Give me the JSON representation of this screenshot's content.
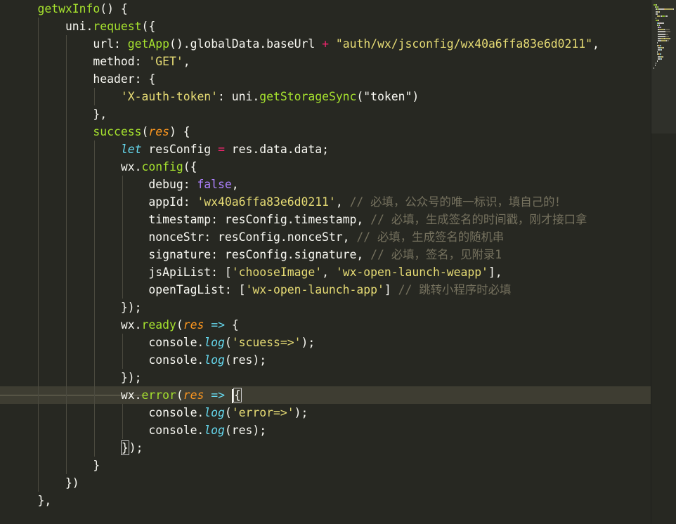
{
  "editor": {
    "lines": [
      [
        {
          "t": "    getwxInfo",
          "c": "fn"
        },
        {
          "t": "() {",
          "c": "plain"
        }
      ],
      [
        {
          "t": "        uni.",
          "c": "plain"
        },
        {
          "t": "request",
          "c": "fn"
        },
        {
          "t": "({",
          "c": "plain"
        }
      ],
      [
        {
          "t": "            url: ",
          "c": "plain"
        },
        {
          "t": "getApp",
          "c": "fn"
        },
        {
          "t": "().globalData.baseUrl ",
          "c": "plain"
        },
        {
          "t": "+",
          "c": "op"
        },
        {
          "t": " ",
          "c": "plain"
        },
        {
          "t": "\"auth/wx/jsconfig/wx40a6ffa83e6d0211\"",
          "c": "str"
        },
        {
          "t": ",",
          "c": "plain"
        }
      ],
      [
        {
          "t": "            method: ",
          "c": "plain"
        },
        {
          "t": "'GET'",
          "c": "str"
        },
        {
          "t": ",",
          "c": "plain"
        }
      ],
      [
        {
          "t": "            header: {",
          "c": "plain"
        }
      ],
      [
        {
          "t": "                ",
          "c": "plain"
        },
        {
          "t": "'X-auth-token'",
          "c": "str"
        },
        {
          "t": ": uni.",
          "c": "plain"
        },
        {
          "t": "getStorageSync",
          "c": "fn"
        },
        {
          "t": "(\"token\")",
          "c": "plain"
        }
      ],
      [
        {
          "t": "            },",
          "c": "plain"
        }
      ],
      [
        {
          "t": "            ",
          "c": "plain"
        },
        {
          "t": "success",
          "c": "fn"
        },
        {
          "t": "(",
          "c": "plain"
        },
        {
          "t": "res",
          "c": "param"
        },
        {
          "t": ") {",
          "c": "plain"
        }
      ],
      [
        {
          "t": "                ",
          "c": "plain"
        },
        {
          "t": "let",
          "c": "kw"
        },
        {
          "t": " resConfig ",
          "c": "plain"
        },
        {
          "t": "=",
          "c": "op"
        },
        {
          "t": " res.data.data;",
          "c": "plain"
        }
      ],
      [
        {
          "t": "                wx.",
          "c": "plain"
        },
        {
          "t": "config",
          "c": "fn"
        },
        {
          "t": "({",
          "c": "plain"
        }
      ],
      [
        {
          "t": "                    debug: ",
          "c": "plain"
        },
        {
          "t": "false",
          "c": "num"
        },
        {
          "t": ",",
          "c": "plain"
        }
      ],
      [
        {
          "t": "                    appId: ",
          "c": "plain"
        },
        {
          "t": "'wx40a6ffa83e6d0211'",
          "c": "str"
        },
        {
          "t": ", ",
          "c": "plain"
        },
        {
          "t": "// 必填，公众号的唯一标识，填自己的！",
          "c": "cmt"
        }
      ],
      [
        {
          "t": "                    timestamp: resConfig.timestamp, ",
          "c": "plain"
        },
        {
          "t": "// 必填，生成签名的时间戳，刚才接口拿",
          "c": "cmt"
        }
      ],
      [
        {
          "t": "                    nonceStr: resConfig.nonceStr, ",
          "c": "plain"
        },
        {
          "t": "// 必填，生成签名的随机串",
          "c": "cmt"
        }
      ],
      [
        {
          "t": "                    signature: resConfig.signature, ",
          "c": "plain"
        },
        {
          "t": "// 必填，签名，见附录1",
          "c": "cmt"
        }
      ],
      [
        {
          "t": "                    jsApiList: [",
          "c": "plain"
        },
        {
          "t": "'chooseImage'",
          "c": "str"
        },
        {
          "t": ", ",
          "c": "plain"
        },
        {
          "t": "'wx-open-launch-weapp'",
          "c": "str"
        },
        {
          "t": "],",
          "c": "plain"
        }
      ],
      [
        {
          "t": "                    openTagList: [",
          "c": "plain"
        },
        {
          "t": "'wx-open-launch-app'",
          "c": "str"
        },
        {
          "t": "] ",
          "c": "plain"
        },
        {
          "t": "// 跳转小程序时必填",
          "c": "cmt"
        }
      ],
      [
        {
          "t": "                });",
          "c": "plain"
        }
      ],
      [
        {
          "t": "                wx.",
          "c": "plain"
        },
        {
          "t": "ready",
          "c": "fn"
        },
        {
          "t": "(",
          "c": "plain"
        },
        {
          "t": "res",
          "c": "param"
        },
        {
          "t": " ",
          "c": "plain"
        },
        {
          "t": "=>",
          "c": "kw"
        },
        {
          "t": " {",
          "c": "plain"
        }
      ],
      [
        {
          "t": "                    console.",
          "c": "plain"
        },
        {
          "t": "log",
          "c": "kw"
        },
        {
          "t": "(",
          "c": "plain"
        },
        {
          "t": "'scuess=>'",
          "c": "str"
        },
        {
          "t": ");",
          "c": "plain"
        }
      ],
      [
        {
          "t": "                    console.",
          "c": "plain"
        },
        {
          "t": "log",
          "c": "kw"
        },
        {
          "t": "(res);",
          "c": "plain"
        }
      ],
      [
        {
          "t": "                });",
          "c": "plain"
        }
      ],
      [
        {
          "t": "                wx.",
          "c": "plain"
        },
        {
          "t": "error",
          "c": "fn"
        },
        {
          "t": "(",
          "c": "plain"
        },
        {
          "t": "res",
          "c": "param"
        },
        {
          "t": " ",
          "c": "plain"
        },
        {
          "t": "=>",
          "c": "kw"
        },
        {
          "t": " ",
          "c": "plain"
        },
        {
          "t": "{",
          "c": "plain",
          "match": true,
          "cursor": true
        }
      ],
      [
        {
          "t": "                    console.",
          "c": "plain"
        },
        {
          "t": "log",
          "c": "kw"
        },
        {
          "t": "(",
          "c": "plain"
        },
        {
          "t": "'error=>'",
          "c": "str"
        },
        {
          "t": ");",
          "c": "plain"
        }
      ],
      [
        {
          "t": "                    console.",
          "c": "plain"
        },
        {
          "t": "log",
          "c": "kw"
        },
        {
          "t": "(res);",
          "c": "plain"
        }
      ],
      [
        {
          "t": "                ",
          "c": "plain"
        },
        {
          "t": "}",
          "c": "plain",
          "match": true
        },
        {
          "t": ");",
          "c": "plain"
        }
      ],
      [
        {
          "t": "            }",
          "c": "plain"
        }
      ],
      [
        {
          "t": "        })",
          "c": "plain"
        }
      ],
      [
        {
          "t": "    },",
          "c": "plain"
        }
      ],
      [
        {
          "t": "",
          "c": "plain"
        }
      ]
    ],
    "current_line_index": 22,
    "theme": {
      "background": "#272822",
      "current_line": "#3e3d32",
      "plain": "#f8f8f2",
      "function": "#a6e22e",
      "string": "#e6db74",
      "keyword": "#66d9ef",
      "operator": "#f92672",
      "constant": "#ae81ff",
      "parameter": "#fd971f",
      "comment": "#75715e"
    }
  }
}
